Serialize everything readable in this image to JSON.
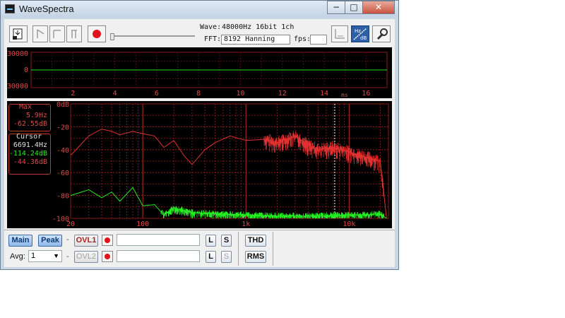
{
  "window": {
    "title": "WaveSpectra",
    "minimize_glyph": "−",
    "maximize_glyph": "□",
    "close_glyph": "✕"
  },
  "toolbar": {
    "buttons": [
      "open-file-icon",
      "play-icon",
      "stop-icon",
      "pause-icon",
      "record-icon"
    ],
    "wave_label": "Wave:",
    "wave_value": "48000Hz 16bit 1ch",
    "fft_label": "FFT:",
    "fft_value": "8192 Hanning",
    "fps_label": "fps:",
    "fps_value": "",
    "right_buttons": [
      "scale-icon",
      "hz-db-icon",
      "wrench-icon"
    ]
  },
  "scope": {
    "y_ticks": [
      "30000",
      "0",
      "-30000"
    ],
    "x_ticks": [
      "2",
      "4",
      "6",
      "8",
      "10",
      "12",
      "14",
      "16"
    ],
    "x_unit": "ms"
  },
  "spectrum": {
    "y_ticks": [
      "0dB",
      "-20",
      "-40",
      "-60",
      "-80",
      "-100"
    ],
    "x_ticks": [
      "20",
      "100",
      "1k",
      "10k"
    ],
    "max_panel": {
      "title": "Max",
      "freq": "5.9Hz",
      "level": "-62.55dB"
    },
    "cursor_panel": {
      "title": "Cursor",
      "freq": "6691.4Hz",
      "level1": "-114.24dB",
      "level2": "-44.36dB"
    },
    "colors": {
      "grid": "#7a1a1a",
      "red_trace": "#e03030",
      "green_trace": "#22ee22",
      "label": "#e04848"
    }
  },
  "bottom": {
    "main_label": "Main",
    "peak_label": "Peak",
    "dash": "-",
    "ovl1_label": "OVL1",
    "ovl2_label": "OVL2",
    "l_label": "L",
    "s_label": "S",
    "thd_label": "THD",
    "rms_label": "RMS",
    "avg_label": "Avg:",
    "avg_value": "1"
  },
  "chart_data": {
    "type": "line",
    "x_scale": "log",
    "xlim": [
      20,
      24000
    ],
    "ylim": [
      -100,
      0
    ],
    "y_unit": "dB",
    "series": [
      {
        "color": "#e03030",
        "x": [
          20,
          30,
          40,
          50,
          60,
          80,
          100,
          130,
          160,
          200,
          250,
          300,
          400,
          500,
          700,
          1000,
          1500,
          2000,
          3000,
          4000,
          5000,
          7000,
          10000,
          15000,
          20000,
          23000
        ],
        "y": [
          -45,
          -28,
          -22,
          -24,
          -27,
          -24,
          -26,
          -28,
          -38,
          -32,
          -45,
          -53,
          -40,
          -34,
          -28,
          -32,
          -31,
          -34,
          -28,
          -36,
          -40,
          -38,
          -42,
          -47,
          -50,
          -100
        ]
      },
      {
        "color": "#22ee22",
        "x": [
          20,
          30,
          40,
          50,
          60,
          80,
          100,
          130,
          160,
          200,
          300,
          500,
          1000,
          2000,
          5000,
          10000,
          15000,
          20000,
          23000
        ],
        "y": [
          -80,
          -75,
          -82,
          -77,
          -85,
          -73,
          -89,
          -88,
          -97,
          -91,
          -95,
          -96,
          -97,
          -98,
          -98,
          -97,
          -97,
          -96,
          -100
        ]
      }
    ]
  }
}
